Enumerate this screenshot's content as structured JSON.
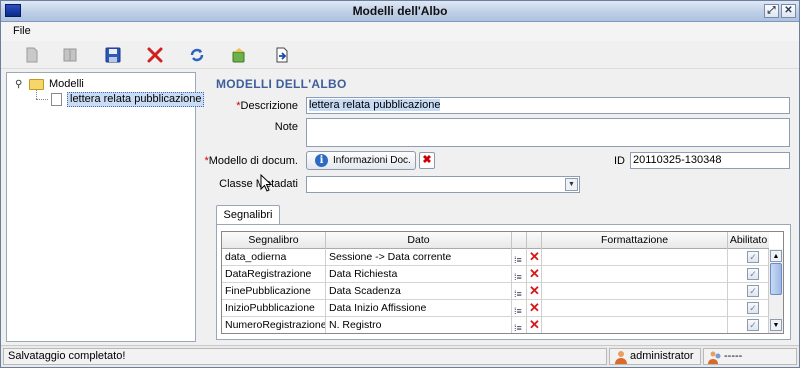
{
  "window": {
    "title": "Modelli dell'Albo"
  },
  "titlebar": {
    "minimize_glyph": "⤢",
    "close_glyph": "✕"
  },
  "menu": {
    "file": "File"
  },
  "toolbar": {
    "icons": [
      "new-icon",
      "book-icon",
      "save-icon",
      "delete-icon",
      "refresh-icon",
      "export-icon",
      "import-icon"
    ]
  },
  "tree": {
    "root_label": "Modelli",
    "child_label": "lettera relata pubblicazione",
    "expander": "⚲"
  },
  "form": {
    "section_title": "MODELLI DELL'ALBO",
    "required_mark": "*",
    "descrizione_label": "Descrizione",
    "descrizione_value": "lettera relata pubblicazione",
    "note_label": "Note",
    "note_value": "",
    "modello_label": "Modello di docum.",
    "info_button_label": "Informazioni Doc.",
    "info_glyph": "i",
    "clear_glyph": "✖",
    "id_label": "ID",
    "id_value": "20110325-130348",
    "classe_label": "Classe Metadati",
    "classe_value": "",
    "combo_arrow": "▼"
  },
  "tabs": {
    "segnalibri": "Segnalibri"
  },
  "grid": {
    "headers": {
      "segnalibro": "Segnalibro",
      "dato": "Dato",
      "formattazione": "Formattazione",
      "abilitato": "Abilitato"
    },
    "rows": [
      {
        "segnalibro": "data_odierna",
        "dato": "Sessione -> Data corrente",
        "formattazione": "",
        "abilitato": "✓"
      },
      {
        "segnalibro": "DataRegistrazione",
        "dato": "Data Richiesta",
        "formattazione": "",
        "abilitato": "✓"
      },
      {
        "segnalibro": "FinePubblicazione",
        "dato": "Data Scadenza",
        "formattazione": "",
        "abilitato": "✓"
      },
      {
        "segnalibro": "InizioPubblicazione",
        "dato": "Data Inizio Affissione",
        "formattazione": "",
        "abilitato": "✓"
      },
      {
        "segnalibro": "NumeroRegistrazione",
        "dato": "N. Registro",
        "formattazione": "",
        "abilitato": "✓"
      }
    ],
    "tree_glyph": "⁞≡",
    "delete_glyph": "✕",
    "scroll_up": "▲",
    "scroll_down": "▼"
  },
  "status": {
    "message": "Salvataggio completato!",
    "user": "administrator",
    "secondary": "-----"
  },
  "colors": {
    "section_title": "#3e5f9b",
    "required": "#d10000",
    "delete_red": "#d21a1a"
  }
}
